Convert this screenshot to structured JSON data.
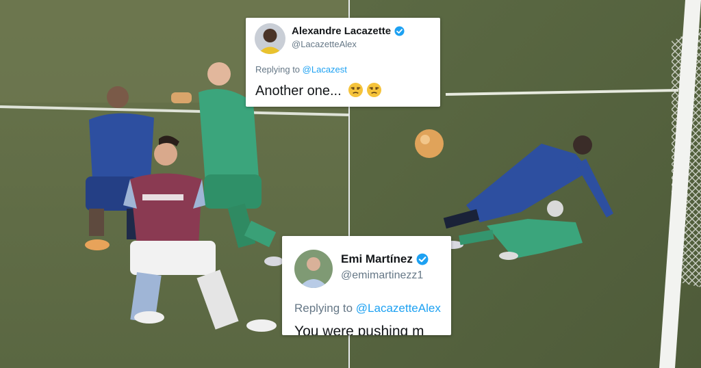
{
  "image": {
    "panels": [
      {
        "label": "left-scene",
        "description_icon": "football-players-scene"
      },
      {
        "label": "right-scene",
        "description_icon": "goal-area-scene"
      }
    ],
    "colors": {
      "pitch": "#5e6b45",
      "home_kit_claret": "#8a3a52",
      "away_kit_blue": "#2d4fa0",
      "keeper_green": "#3ba57c",
      "twitter_blue": "#1da1f2"
    }
  },
  "tweets": [
    {
      "display_name": "Alexandre Lacazette",
      "handle": "@LacazetteAlex",
      "replying_prefix": "Replying to ",
      "replying_handle": "@Lacazest",
      "text": "Another one...",
      "emoji": [
        "unamused-face-icon",
        "unamused-face-icon"
      ],
      "verified": true
    },
    {
      "display_name": "Emi Martínez",
      "handle": "@emimartinezz1",
      "replying_prefix": "Replying to ",
      "replying_handle": "@LacazetteAlex",
      "text": "You were pushing m",
      "verified": true
    }
  ]
}
